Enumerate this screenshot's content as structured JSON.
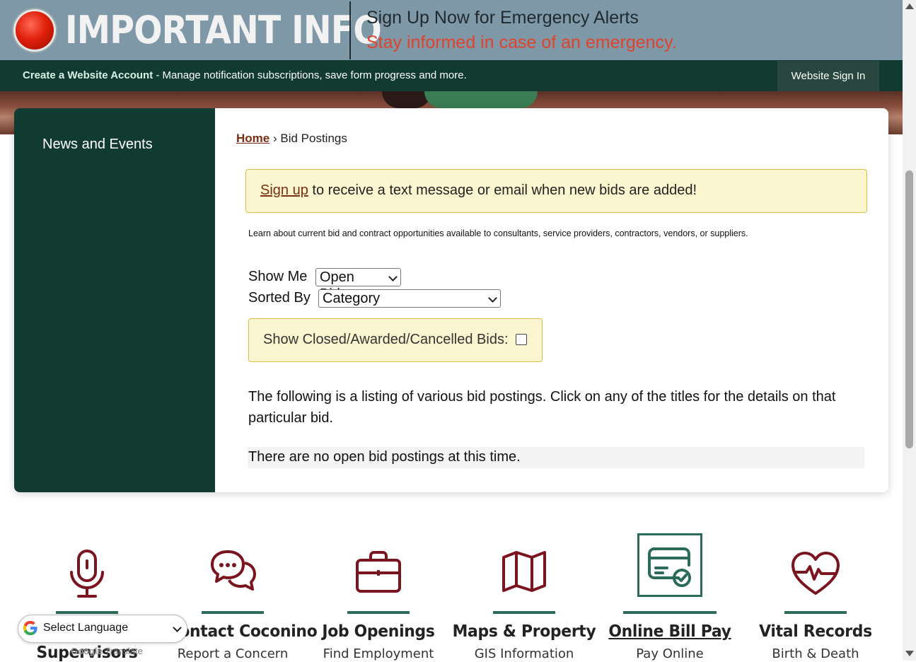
{
  "banner": {
    "heading": "IMPORTANT INFO",
    "alert_title": "Sign Up Now for Emergency Alerts",
    "alert_subtitle": "Stay informed in case of an emergency."
  },
  "account_bar": {
    "create_link": "Create a Website Account",
    "description": " - Manage notification subscriptions, save form progress and more.",
    "sign_in": "Website Sign In"
  },
  "sidebar": {
    "items": [
      {
        "label": "News and Events"
      }
    ]
  },
  "breadcrumb": {
    "home": "Home",
    "separator": "›",
    "current": "Bid Postings"
  },
  "signup_notice": {
    "link": "Sign up",
    "text": " to receive a text message or email when new bids are added!"
  },
  "intro": "Learn about current bid and contract opportunities available to consultants, service providers, contractors, vendors, or suppliers.",
  "filters": {
    "show_me_label": "Show Me",
    "show_me_value": "Open Bids",
    "sorted_by_label": "Sorted By",
    "sorted_by_value": "Category",
    "closed_label": "Show Closed/Awarded/Cancelled Bids:"
  },
  "listing_text": "The following is a listing of various bid postings. Click on any of the titles for the details on that particular bid.",
  "no_bids": "There are no open bid postings at this time.",
  "quick_links": [
    {
      "title": "Supervisors",
      "subtitle": "",
      "icon": "microphone-icon"
    },
    {
      "title": "Contact Coconino",
      "subtitle": "Report a Concern",
      "icon": "chat-bubbles-icon"
    },
    {
      "title": "Job Openings",
      "subtitle": "Find Employment",
      "icon": "briefcase-icon"
    },
    {
      "title": "Maps & Property",
      "subtitle": "GIS Information",
      "icon": "map-icon"
    },
    {
      "title": "Online Bill Pay",
      "subtitle": "Pay Online",
      "icon": "card-check-icon"
    },
    {
      "title": "Vital Records",
      "subtitle": "Birth & Death",
      "icon": "heart-pulse-icon"
    }
  ],
  "translate": {
    "label": "Select Language",
    "powered": "Translate"
  },
  "colors": {
    "dark_green": "#113a30",
    "banner_gray": "#7f98a8",
    "alert_red": "#e0432b",
    "link_brown": "#7a2e12",
    "icon_maroon": "#7a1520",
    "accent_teal": "#2b6b5a",
    "notice_yellow": "#fbf6cf"
  }
}
